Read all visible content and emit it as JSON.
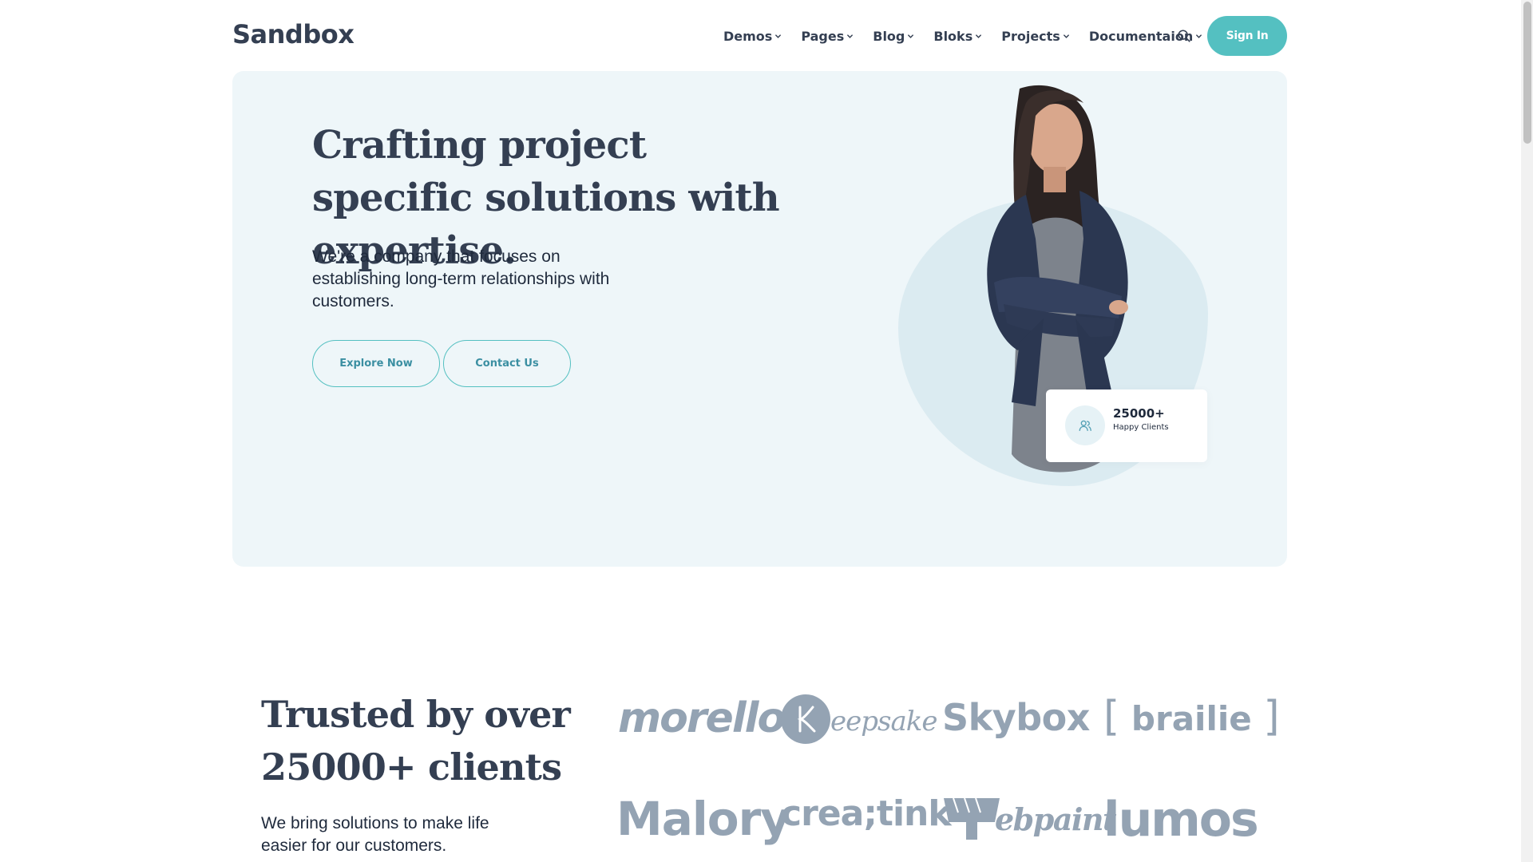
{
  "brand": {
    "logo_text": "Sandbox",
    "accent_color": "#54c0c1",
    "text_color": "#343f52"
  },
  "nav": {
    "items": [
      {
        "label": "Demos",
        "icon": "chevron-down-icon"
      },
      {
        "label": "Pages",
        "icon": "chevron-down-icon"
      },
      {
        "label": "Blog",
        "icon": "chevron-down-icon"
      },
      {
        "label": "Bloks",
        "icon": "chevron-down-icon"
      },
      {
        "label": "Projects",
        "icon": "chevron-down-icon"
      },
      {
        "label": "Documentaion",
        "icon": "chevron-down-icon"
      }
    ],
    "search_icon": "search-icon",
    "signin_label": "Sign In"
  },
  "hero": {
    "title": "Crafting project specific solutions with expertise.",
    "subtitle": "We're a company that focuses on establishing long-term relationships with customers.",
    "explore_label": "Explore Now",
    "contact_label": "Contact Us",
    "background_color": "#eef6f9",
    "stat": {
      "value": "25000+",
      "label": "Happy Clients",
      "icon": "users-icon"
    }
  },
  "trusted": {
    "title": "Trusted by over 25000+ clients",
    "subtitle": "We bring solutions to make life easier for our customers.",
    "clients": {
      "morello": "morello",
      "keepsake": "eepsake",
      "skybox": "Skybox",
      "brailie": "brailie",
      "malory": "Malory",
      "creatink": "crea;tink",
      "webpaint": "ebpaint",
      "lumos": "lumos"
    }
  }
}
